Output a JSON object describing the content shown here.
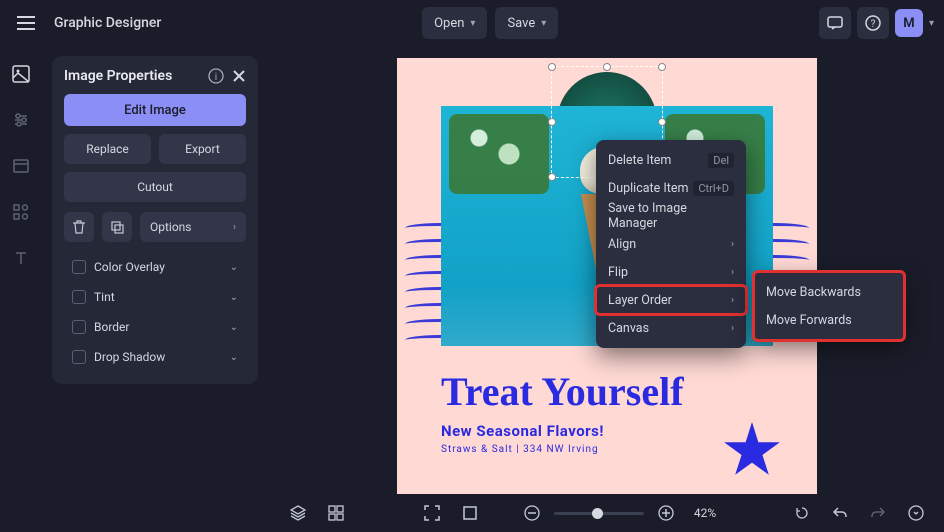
{
  "app": {
    "title": "Graphic Designer"
  },
  "topbar": {
    "open": "Open",
    "save": "Save",
    "avatar_letter": "M"
  },
  "panel": {
    "title": "Image Properties",
    "edit": "Edit Image",
    "replace": "Replace",
    "export": "Export",
    "cutout": "Cutout",
    "options": "Options",
    "props": [
      {
        "label": "Color Overlay"
      },
      {
        "label": "Tint"
      },
      {
        "label": "Border"
      },
      {
        "label": "Drop Shadow"
      }
    ]
  },
  "artboard": {
    "headline": "Treat Yourself",
    "subhead": "New Seasonal Flavors!",
    "detail": "Straws & Salt  |  334 NW Irving"
  },
  "context_menu": {
    "items": [
      {
        "label": "Delete Item",
        "shortcut": "Del"
      },
      {
        "label": "Duplicate Item",
        "shortcut": "Ctrl+D"
      },
      {
        "label": "Save to Image Manager"
      },
      {
        "label": "Align",
        "submenu": true
      },
      {
        "label": "Flip",
        "submenu": true
      },
      {
        "label": "Layer Order",
        "submenu": true,
        "highlighted": true
      },
      {
        "label": "Canvas",
        "submenu": true
      }
    ],
    "submenu": {
      "items": [
        {
          "label": "Move Backwards"
        },
        {
          "label": "Move Forwards"
        }
      ]
    }
  },
  "bottombar": {
    "zoom": "42%"
  }
}
